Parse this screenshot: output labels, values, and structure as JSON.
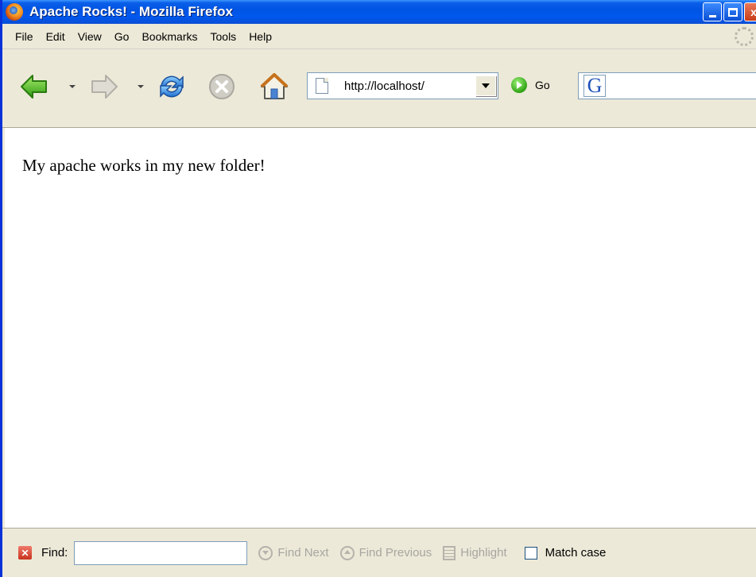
{
  "window": {
    "title": "Apache Rocks! - Mozilla Firefox",
    "buttons": {
      "minimize": "_",
      "maximize": "□",
      "close": "x"
    }
  },
  "menu": [
    "File",
    "Edit",
    "View",
    "Go",
    "Bookmarks",
    "Tools",
    "Help"
  ],
  "toolbar": {
    "icons": [
      "back-icon",
      "forward-icon",
      "reload-icon",
      "stop-icon",
      "home-icon"
    ],
    "url": "http://localhost/",
    "go_label": "Go",
    "search_engine_glyph": "G"
  },
  "page": {
    "body_text": "My apache works in my new folder!"
  },
  "findbar": {
    "find_label": "Find:",
    "find_value": "",
    "find_next": "Find Next",
    "find_previous": "Find Previous",
    "highlight": "Highlight",
    "match_case": "Match case",
    "match_case_checked": false
  },
  "colors": {
    "titlebar": "#0054e3",
    "chrome": "#ece9d8",
    "input_border": "#7f9db9"
  }
}
